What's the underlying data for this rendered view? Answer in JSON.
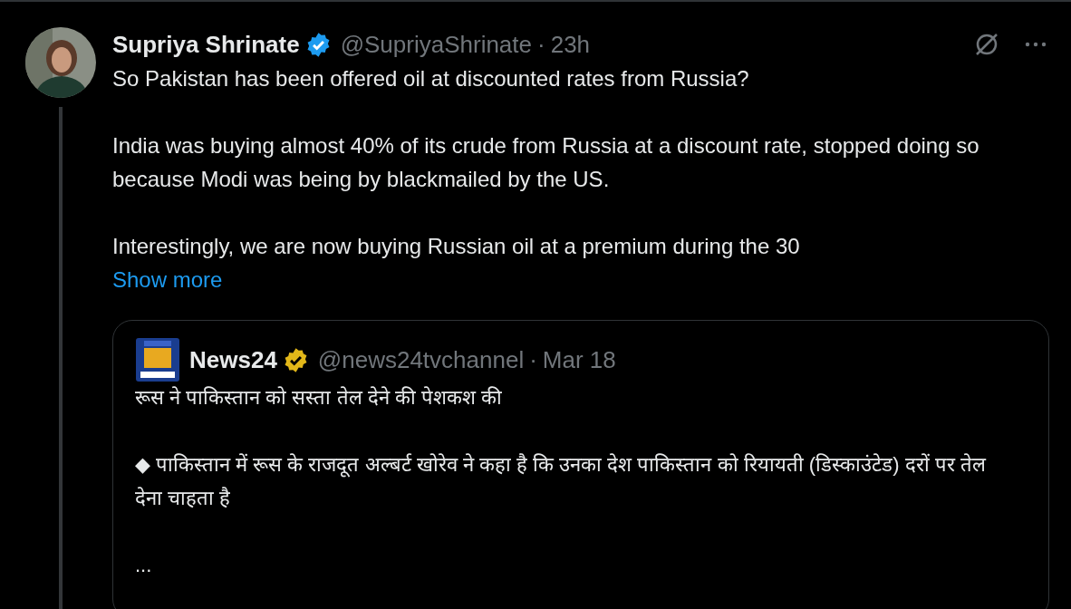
{
  "post": {
    "author": {
      "name": "Supriya Shrinate",
      "verified": true,
      "color": "#1d9bf0",
      "handle": "@SupriyaShrinate",
      "separator": "·",
      "time": "23h"
    },
    "paragraphs": [
      "So Pakistan has been offered oil at discounted rates from Russia?",
      "India was buying almost 40% of its crude from Russia at a discount rate, stopped doing so because Modi was being by blackmailed by the US.",
      "Interestingly, we are now buying Russian oil at a premium during the 30"
    ],
    "show_more": "Show more",
    "quote": {
      "author": {
        "name": "News24",
        "verified": true,
        "color": "#e2b719",
        "handle": "@news24tvchannel",
        "separator": "·",
        "time": "Mar 18"
      },
      "paragraphs": [
        "रूस ने पाकिस्तान को सस्ता तेल देने की पेशकश की",
        "◆ पाकिस्तान में रूस के राजदूत अल्बर्ट खोरेव ने कहा है कि उनका देश पाकिस्तान को रियायती (डिस्काउंटेड) दरों पर तेल देना चाहता है",
        "..."
      ]
    }
  }
}
